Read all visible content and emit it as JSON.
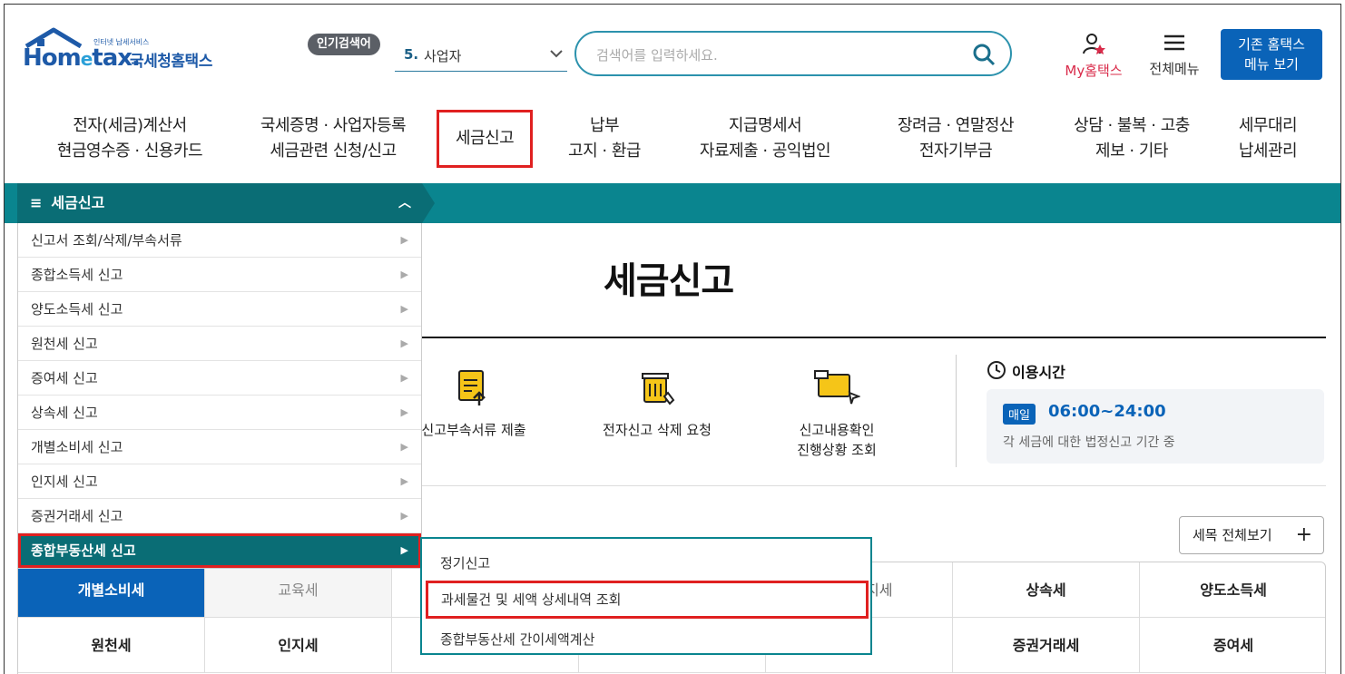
{
  "header": {
    "logo_word_pre": "Hom",
    "logo_word_e": "e",
    "logo_word_post": "tax.",
    "logo_tagline": "인터넷 납세서비스",
    "logo_kr": "국세청홈택스",
    "popular_badge": "인기검색어",
    "popular_rank": "5.",
    "popular_term": "사업자",
    "search_placeholder": "검색어를 입력하세요.",
    "my_hometax": "My홈택스",
    "all_menu": "전체메뉴",
    "legacy_line1": "기존 홈택스",
    "legacy_line2": "메뉴 보기"
  },
  "gnb": [
    {
      "l1": "전자(세금)계산서",
      "l2": "현금영수증 · 신용카드"
    },
    {
      "l1": "국세증명 · 사업자등록",
      "l2": "세금관련 신청/신고"
    },
    {
      "l1": "세금신고",
      "l2": ""
    },
    {
      "l1": "납부",
      "l2": "고지 · 환급"
    },
    {
      "l1": "지급명세서",
      "l2": "자료제출 · 공익법인"
    },
    {
      "l1": "장려금 · 연말정산",
      "l2": "전자기부금"
    },
    {
      "l1": "상담 · 불복 · 고충",
      "l2": "제보 · 기타"
    },
    {
      "l1": "세무대리",
      "l2": "납세관리"
    }
  ],
  "lnb": {
    "title": "세금신고",
    "items": [
      "신고서 조회/삭제/부속서류",
      "종합소득세 신고",
      "양도소득세 신고",
      "원천세 신고",
      "증여세 신고",
      "상속세 신고",
      "개별소비세 신고",
      "인지세 신고",
      "증권거래세 신고",
      "종합부동산세 신고"
    ],
    "submenu": [
      "정기신고",
      "과세물건 및 세액 상세내역 조회",
      "종합부동산세 간이세액계산"
    ]
  },
  "main": {
    "title": "세금신고",
    "quick": [
      {
        "l1": "신고부속서류 제출",
        "l2": ""
      },
      {
        "l1": "전자신고 삭제 요청",
        "l2": ""
      },
      {
        "l1": "신고내용확인",
        "l2": "진행상황 조회"
      }
    ],
    "usage_title": "이용시간",
    "usage_badge": "매일",
    "usage_time": "06:00~24:00",
    "usage_desc": "각 세금에 대한 법정신고 기간 중",
    "all_tax_button": "세목 전체보기",
    "tax_row1": [
      "개별소비세",
      "교육세",
      "",
      "",
      "지세",
      "상속세",
      "양도소득세"
    ],
    "tax_row2": [
      "원천세",
      "인지세",
      "",
      "",
      "",
      "증권거래세",
      "증여세"
    ]
  },
  "colors": {
    "teal": "#0a858f",
    "teal_dark": "#0a6d75",
    "blue": "#0a63b8",
    "highlight": "#e02020"
  }
}
